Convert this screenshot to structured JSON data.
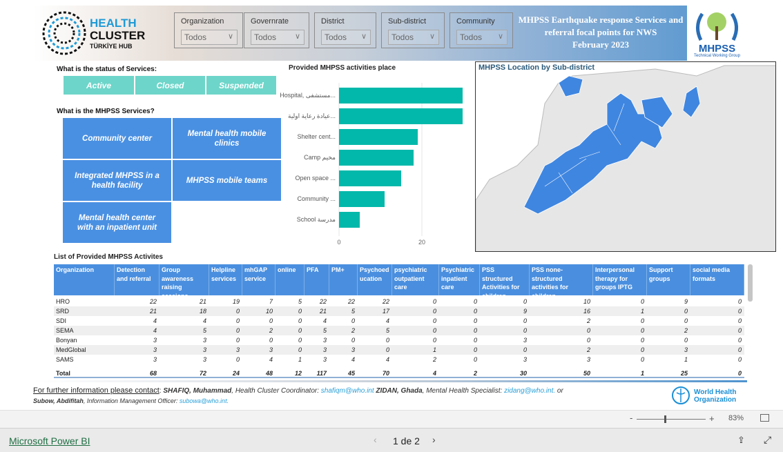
{
  "header": {
    "logo_left": {
      "line1": "HEALTH",
      "line2": "CLUSTER",
      "line3": "TÜRKİYE HUB"
    },
    "filters": [
      {
        "label": "Organization",
        "value": "Todos"
      },
      {
        "label": "Governrate",
        "value": "Todos"
      },
      {
        "label": "District",
        "value": "Todos"
      },
      {
        "label": "Sub-district",
        "value": "Todos"
      },
      {
        "label": "Community",
        "value": "Todos"
      }
    ],
    "title_lines": [
      "MHPSS Earthquake response Services and",
      "referral focal points for NWS",
      "February 2023"
    ],
    "logo_right": {
      "text": "MHPSS",
      "subtitle": "Technical Working Group",
      "arc_text": "MENTAL HEALTH & PSYCHOSOCIAL SUPPORT"
    }
  },
  "status": {
    "label": "What is the status of Services:",
    "buttons": [
      "Active",
      "Closed",
      "Suspended"
    ],
    "color": "#6dd5c9"
  },
  "services": {
    "label": "What is the MHPSS Services?",
    "tiles": [
      "Community center",
      "Mental health mobile clinics",
      "Integrated MHPSS in a health facility",
      "MHPSS mobile teams",
      "Mental health center with an inpatient unit"
    ],
    "color": "#4a90e2"
  },
  "chart_data": {
    "type": "bar",
    "orientation": "horizontal",
    "title": "Provided MHPSS activities place",
    "categories": [
      "Hospital, مستشفى...",
      "عيادة رعاية اولية...",
      "Shelter cent...",
      "Camp مخيم",
      "Open space ...",
      "Community ...",
      "School مدرسة"
    ],
    "values": [
      30,
      30,
      19,
      18,
      15,
      11,
      5
    ],
    "xticks": [
      "0",
      "20"
    ],
    "xlim": [
      0,
      30
    ],
    "color": "#01b8aa",
    "grid": true
  },
  "map": {
    "title": "MHPSS Location by Sub-district",
    "fill": "#3f86e0",
    "base": "#e8e8e8"
  },
  "table": {
    "title": "List of Provided MHPSS Activites",
    "columns": [
      "Organization",
      "Detection and referral",
      "Group awareness raising sessions",
      "Helpline services",
      "mhGAP service",
      "online",
      "PFA",
      "PM+",
      "Psychoed ucation",
      "psychiatric outpatient care",
      "Psychiatric inpatient care",
      "PSS structured Activities for children",
      "PSS none-structured activities for children",
      "Interpersonal therapy for groups IPTG",
      "Support groups",
      "social media formats"
    ],
    "rows": [
      [
        "HRO",
        "22",
        "21",
        "19",
        "7",
        "5",
        "22",
        "22",
        "22",
        "0",
        "0",
        "0",
        "10",
        "0",
        "9",
        "0"
      ],
      [
        "SRD",
        "21",
        "18",
        "0",
        "10",
        "0",
        "21",
        "5",
        "17",
        "0",
        "0",
        "9",
        "16",
        "1",
        "0",
        "0"
      ],
      [
        "SDI",
        "4",
        "4",
        "0",
        "0",
        "0",
        "4",
        "0",
        "4",
        "0",
        "0",
        "0",
        "2",
        "0",
        "0",
        "0"
      ],
      [
        "SEMA",
        "4",
        "5",
        "0",
        "2",
        "0",
        "5",
        "2",
        "5",
        "0",
        "0",
        "0",
        "0",
        "0",
        "2",
        "0"
      ],
      [
        "Bonyan",
        "3",
        "3",
        "0",
        "0",
        "0",
        "3",
        "0",
        "0",
        "0",
        "0",
        "3",
        "0",
        "0",
        "0",
        "0"
      ],
      [
        "MedGlobal",
        "3",
        "3",
        "3",
        "3",
        "0",
        "3",
        "3",
        "0",
        "1",
        "0",
        "0",
        "2",
        "0",
        "3",
        "0"
      ],
      [
        "SAMS",
        "3",
        "3",
        "0",
        "4",
        "1",
        "3",
        "4",
        "4",
        "2",
        "0",
        "3",
        "3",
        "0",
        "1",
        "0"
      ]
    ],
    "total": [
      "Total",
      "68",
      "72",
      "24",
      "48",
      "12",
      "117",
      "45",
      "70",
      "4",
      "2",
      "30",
      "50",
      "1",
      "25",
      "0"
    ]
  },
  "footer": {
    "contact_label": "For further information please contact",
    "p1_name": "SHAFIQ, Muhammad",
    "p1_role": ", Health Cluster Coordinator: ",
    "p1_email": "shafiqm@who.int",
    "p2_name": " ZIDAN, Ghada",
    "p2_role": ", Mental Health Specialist: ",
    "p2_email": "zidang@who.int.",
    "or": " or",
    "p3_name": "Subow, Abdifitah",
    "p3_role": ", Information Management Officer: ",
    "p3_email": "subowa@who.int.",
    "who_logo": "World Health Organization"
  },
  "viewer": {
    "zoom_minus": "-",
    "zoom_plus": "+",
    "zoom_level": "83%",
    "zoom_fraction": 0.4,
    "brand_link": "Microsoft Power BI",
    "page": "1 de 2"
  }
}
